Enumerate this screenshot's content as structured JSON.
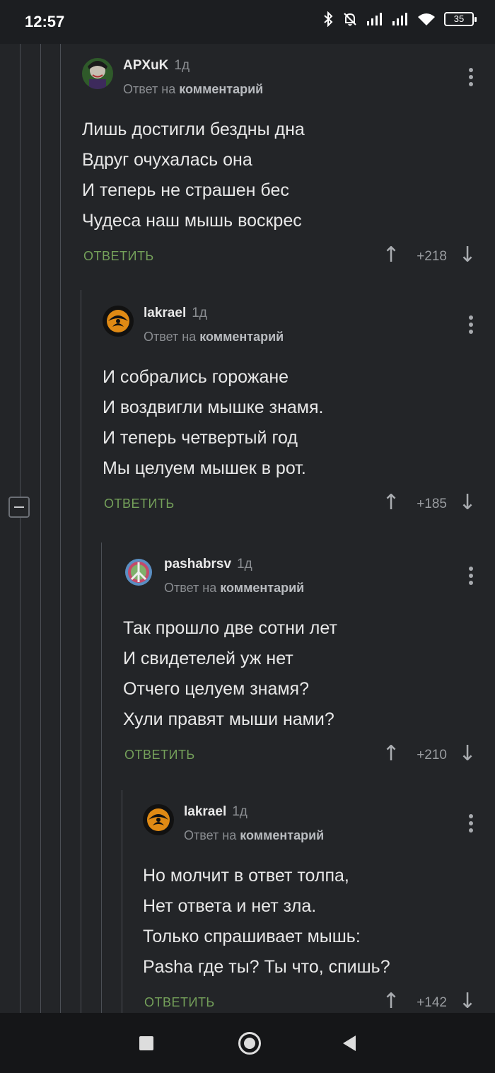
{
  "status_bar": {
    "time": "12:57",
    "icons": [
      "bluetooth-icon",
      "bell-off-icon",
      "signal-icon",
      "signal-icon",
      "wifi-icon"
    ],
    "battery": "35"
  },
  "comments": [
    {
      "author": "APXuK",
      "age": "1д",
      "reply_prefix": "Ответ на",
      "reply_target": "комментарий",
      "lines": [
        "Лишь достигли бездны дна",
        "Вдруг очухалась она",
        "И теперь не страшен бес",
        "Чудеса наш мышь воскрес"
      ],
      "reply_label": "ОТВЕТИТЬ",
      "score": "+218"
    },
    {
      "author": "lakrael",
      "age": "1д",
      "reply_prefix": "Ответ на",
      "reply_target": "комментарий",
      "lines": [
        "И собрались горожане",
        "И воздвигли мышке знамя.",
        "И теперь четвертый год",
        "Мы целуем мышек в рот."
      ],
      "reply_label": "ОТВЕТИТЬ",
      "score": "+185"
    },
    {
      "author": "pashabrsv",
      "age": "1д",
      "reply_prefix": "Ответ на",
      "reply_target": "комментарий",
      "lines": [
        "Так прошло две сотни лет",
        "И свидетелей уж нет",
        "Отчего целуем знамя?",
        "Хули правят мыши нами?"
      ],
      "reply_label": "ОТВЕТИТЬ",
      "score": "+210"
    },
    {
      "author": "lakrael",
      "age": "1д",
      "reply_prefix": "Ответ на",
      "reply_target": "комментарий",
      "lines": [
        "Но молчит в ответ толпа,",
        "Нет ответа и нет зла.",
        "Только спрашивает мышь:",
        "Pasha где ты? Ты что, спишь?"
      ],
      "reply_label": "ОТВЕТИТЬ",
      "score": "+142"
    }
  ],
  "colors": {
    "background": "#232528",
    "reply_green": "#74a05a",
    "thread_line": "#4b4f55"
  },
  "nav_bar": [
    "recents-button",
    "home-button",
    "back-button"
  ]
}
